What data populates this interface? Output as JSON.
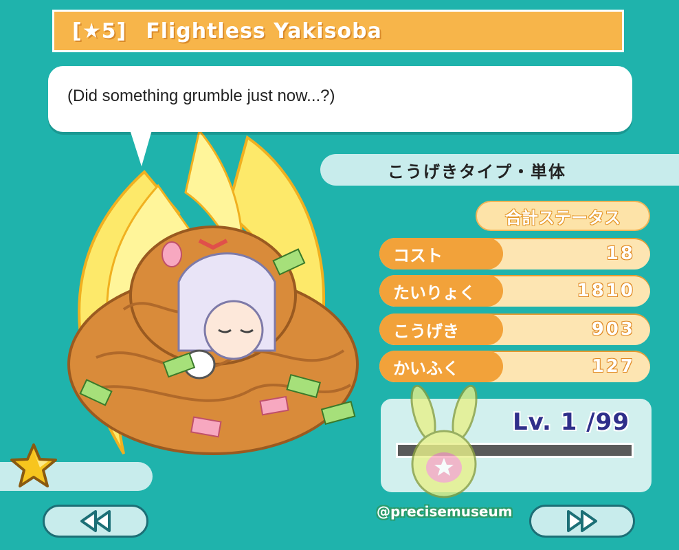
{
  "card": {
    "rarity": "[★5]",
    "name": "Flightless Yakisoba",
    "quote": "(Did something grumble just now...?)",
    "attack_type": "こうげきタイプ・単体",
    "total_status_label": "合計ステータス"
  },
  "stats": [
    {
      "label": "コスト",
      "value": "18"
    },
    {
      "label": "たいりょく",
      "value": "1810"
    },
    {
      "label": "こうげき",
      "value": "903"
    },
    {
      "label": "かいふく",
      "value": "127"
    }
  ],
  "level": {
    "text": "Lv. 1 /99",
    "current": 1,
    "max": 99
  },
  "watermark": "@precisemuseum",
  "icons": {
    "star": "star-icon",
    "prev": "rewind-icon",
    "next": "fast-forward-icon"
  },
  "colors": {
    "background": "#1fb3ac",
    "title_bar": "#f7b54a",
    "stat_label": "#f2a23a",
    "level_text": "#2f2f8a"
  }
}
